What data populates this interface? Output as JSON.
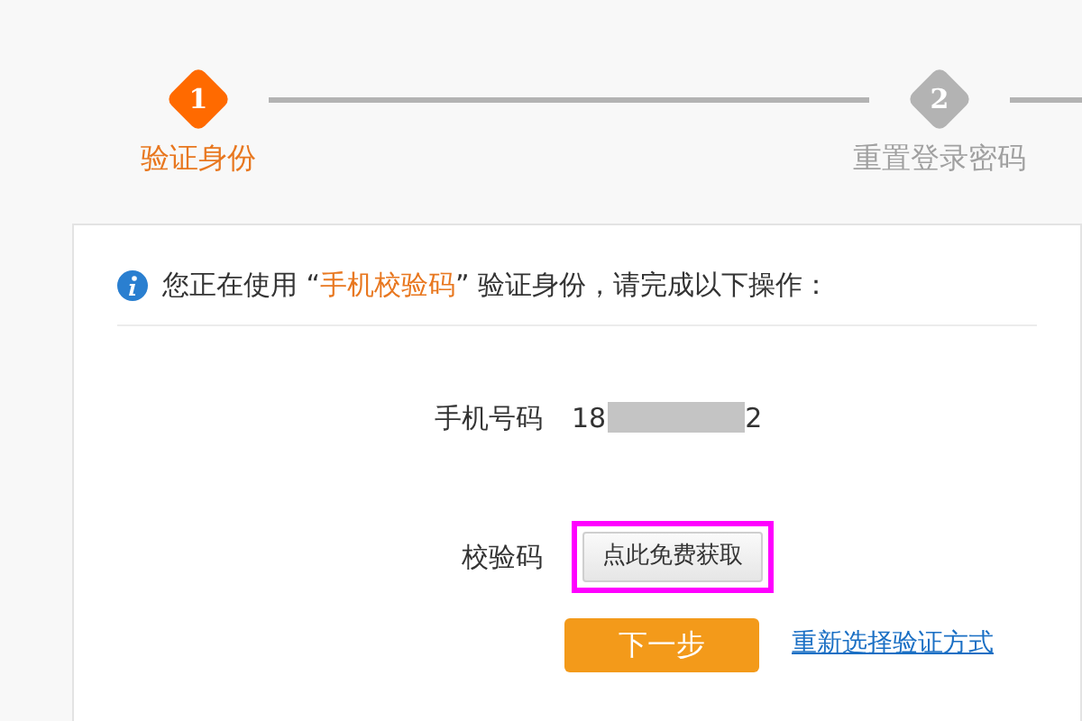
{
  "steps": [
    {
      "number": "1",
      "label": "验证身份",
      "selected": true
    },
    {
      "number": "2",
      "label": "重置登录密码",
      "selected": false
    }
  ],
  "notice": {
    "before": "您正在使用 “",
    "method": "手机校验码",
    "after": "” 验证身份，请完成以下操作："
  },
  "phone": {
    "label": "手机号码",
    "prefix": "18",
    "suffix": "2"
  },
  "code": {
    "label": "校验码",
    "button": "点此免费获取",
    "highlighted": true
  },
  "next_button": "下一步",
  "reselect_link": "重新选择验证方式"
}
